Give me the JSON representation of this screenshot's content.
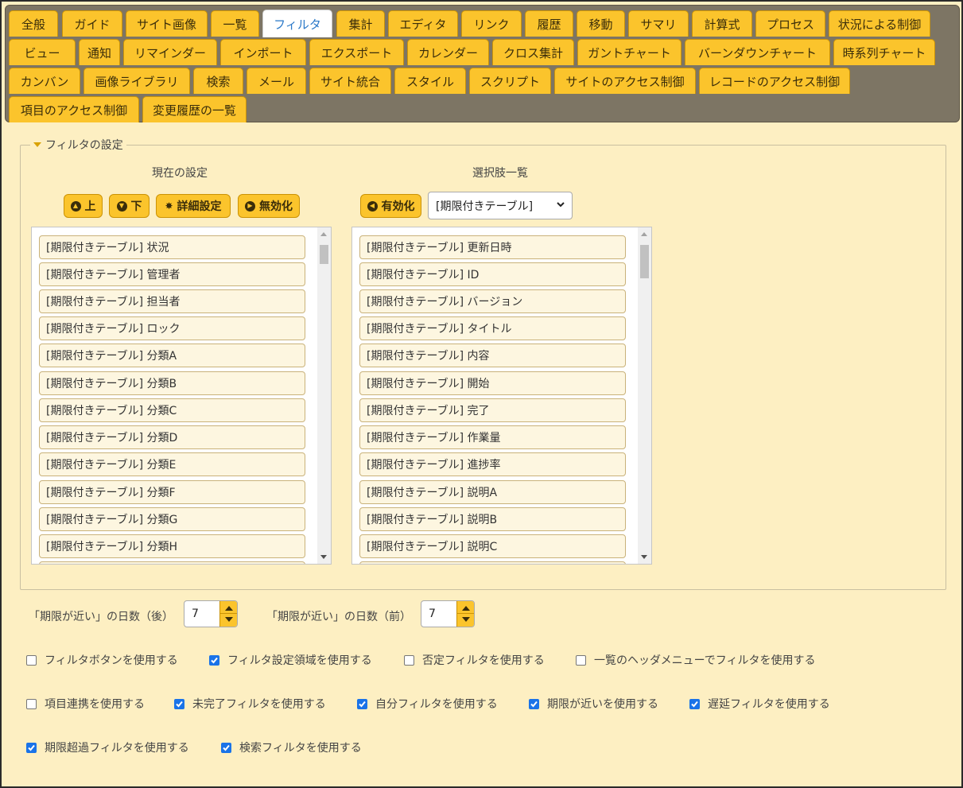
{
  "tabs": [
    {
      "label": "全般",
      "active": false
    },
    {
      "label": "ガイド",
      "active": false
    },
    {
      "label": "サイト画像",
      "active": false
    },
    {
      "label": "一覧",
      "active": false
    },
    {
      "label": "フィルタ",
      "active": true
    },
    {
      "label": "集計",
      "active": false
    },
    {
      "label": "エディタ",
      "active": false
    },
    {
      "label": "リンク",
      "active": false
    },
    {
      "label": "履歴",
      "active": false
    },
    {
      "label": "移動",
      "active": false
    },
    {
      "label": "サマリ",
      "active": false
    },
    {
      "label": "計算式",
      "active": false
    },
    {
      "label": "プロセス",
      "active": false
    },
    {
      "label": "状況による制御",
      "active": false
    },
    {
      "label": "ビュー",
      "active": false
    },
    {
      "label": "通知",
      "active": false
    },
    {
      "label": "リマインダー",
      "active": false
    },
    {
      "label": "インポート",
      "active": false
    },
    {
      "label": "エクスポート",
      "active": false
    },
    {
      "label": "カレンダー",
      "active": false
    },
    {
      "label": "クロス集計",
      "active": false
    },
    {
      "label": "ガントチャート",
      "active": false
    },
    {
      "label": "バーンダウンチャート",
      "active": false
    },
    {
      "label": "時系列チャート",
      "active": false
    },
    {
      "label": "カンバン",
      "active": false
    },
    {
      "label": "画像ライブラリ",
      "active": false
    },
    {
      "label": "検索",
      "active": false
    },
    {
      "label": "メール",
      "active": false
    },
    {
      "label": "サイト統合",
      "active": false
    },
    {
      "label": "スタイル",
      "active": false
    },
    {
      "label": "スクリプト",
      "active": false
    },
    {
      "label": "サイトのアクセス制御",
      "active": false
    },
    {
      "label": "レコードのアクセス制御",
      "active": false
    },
    {
      "label": "項目のアクセス制御",
      "active": false
    },
    {
      "label": "変更履歴の一覧",
      "active": false
    }
  ],
  "filter_settings": {
    "legend": "フィルタの設定",
    "current": {
      "title": "現在の設定",
      "buttons": {
        "up": "上",
        "down": "下",
        "detail": "詳細設定",
        "disable": "無効化"
      },
      "items": [
        "[期限付きテーブル] 状況",
        "[期限付きテーブル] 管理者",
        "[期限付きテーブル] 担当者",
        "[期限付きテーブル] ロック",
        "[期限付きテーブル] 分類A",
        "[期限付きテーブル] 分類B",
        "[期限付きテーブル] 分類C",
        "[期限付きテーブル] 分類D",
        "[期限付きテーブル] 分類E",
        "[期限付きテーブル] 分類F",
        "[期限付きテーブル] 分類G",
        "[期限付きテーブル] 分類H"
      ]
    },
    "options": {
      "title": "選択肢一覧",
      "enable_button": "有効化",
      "table_select": "[期限付きテーブル]",
      "items": [
        "[期限付きテーブル] 更新日時",
        "[期限付きテーブル] ID",
        "[期限付きテーブル] バージョン",
        "[期限付きテーブル] タイトル",
        "[期限付きテーブル] 内容",
        "[期限付きテーブル] 開始",
        "[期限付きテーブル] 完了",
        "[期限付きテーブル] 作業量",
        "[期限付きテーブル] 進捗率",
        "[期限付きテーブル] 説明A",
        "[期限付きテーブル] 説明B",
        "[期限付きテーブル] 説明C"
      ]
    }
  },
  "near_deadline": {
    "after_label": "「期限が近い」の日数（後）",
    "after_value": "7",
    "before_label": "「期限が近い」の日数（前）",
    "before_value": "7"
  },
  "checkboxes": [
    {
      "label": "フィルタボタンを使用する",
      "checked": false
    },
    {
      "label": "フィルタ設定領域を使用する",
      "checked": true
    },
    {
      "label": "否定フィルタを使用する",
      "checked": false
    },
    {
      "label": "一覧のヘッダメニューでフィルタを使用する",
      "checked": false
    },
    {
      "label": "項目連携を使用する",
      "checked": false
    },
    {
      "label": "未完了フィルタを使用する",
      "checked": true
    },
    {
      "label": "自分フィルタを使用する",
      "checked": true
    },
    {
      "label": "期限が近いを使用する",
      "checked": true
    },
    {
      "label": "遅延フィルタを使用する",
      "checked": true
    },
    {
      "label": "期限超過フィルタを使用する",
      "checked": true
    },
    {
      "label": "検索フィルタを使用する",
      "checked": true
    }
  ],
  "colors": {
    "page_bg": "#fdefc2",
    "tab": "#fbc42c",
    "tab_active_text": "#2a78c8",
    "checkbox_checked": "#1a73e8"
  },
  "icons": {
    "up": "arrow-up-circle-icon",
    "down": "arrow-down-circle-icon",
    "detail": "gear-icon",
    "disable": "arrow-right-circle-icon",
    "enable": "arrow-left-circle-icon",
    "select": "chevron-down-icon"
  }
}
